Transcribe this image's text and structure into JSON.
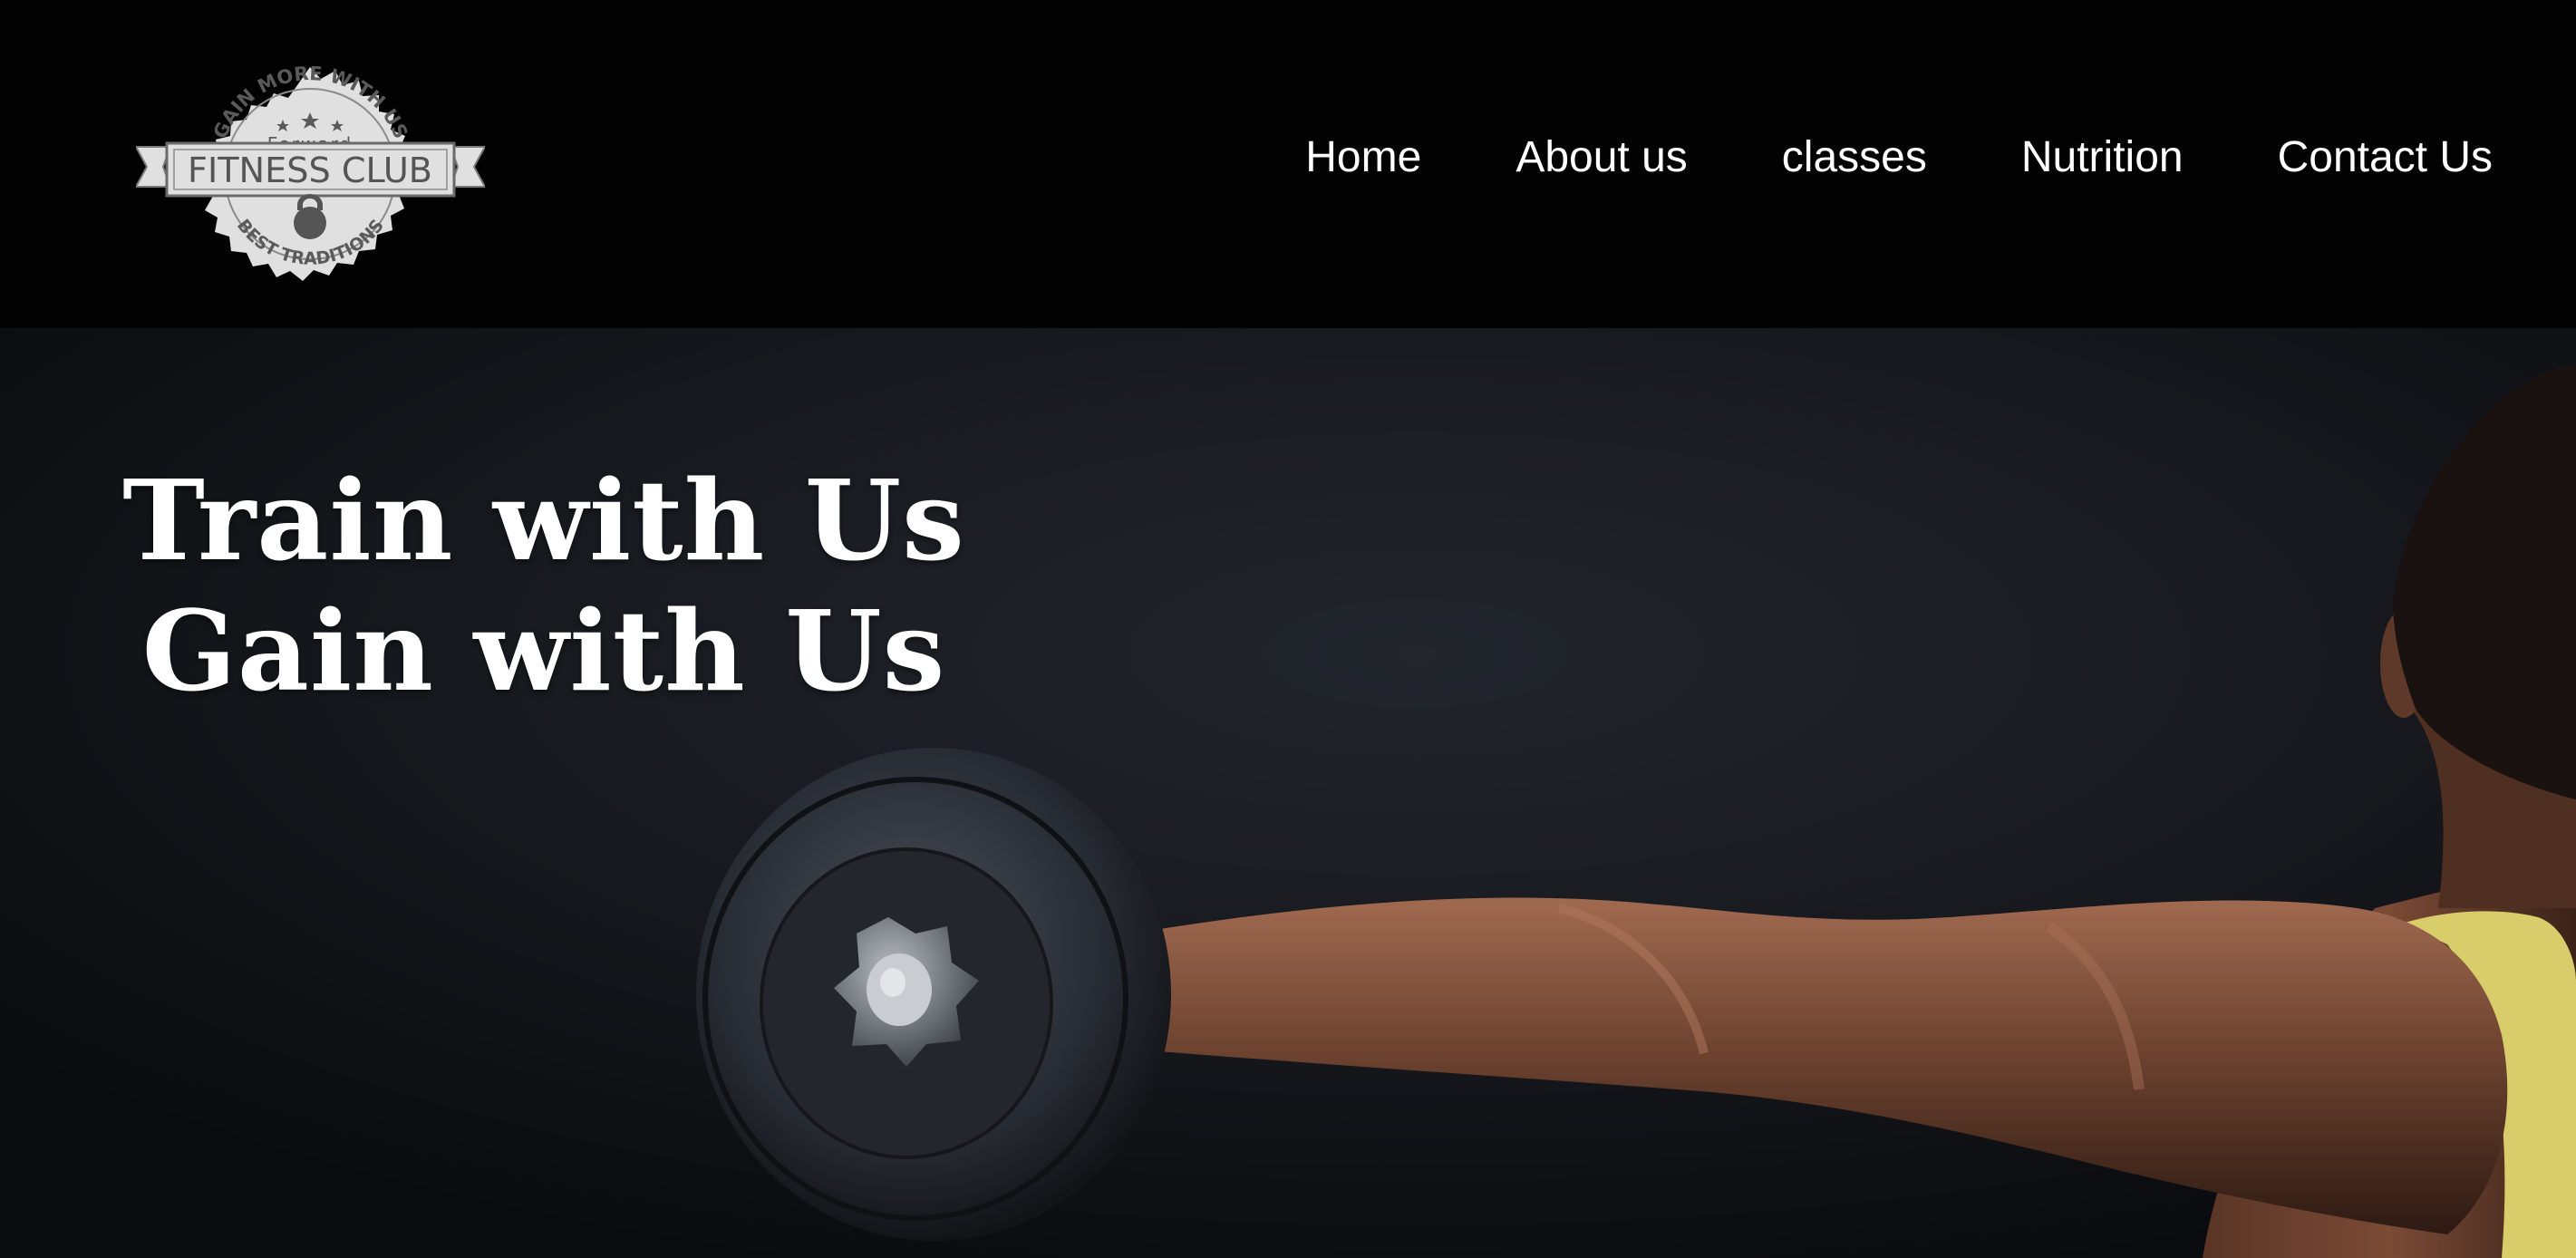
{
  "logo": {
    "arc_top": "GAIN MORE WITH US",
    "subtitle": "Forward",
    "banner": "FITNESS CLUB",
    "arc_bottom": "BEST TRADITIONS"
  },
  "nav": {
    "items": [
      {
        "label": "Home"
      },
      {
        "label": "About us"
      },
      {
        "label": "classes"
      },
      {
        "label": "Nutrition"
      },
      {
        "label": "Contact Us"
      }
    ]
  },
  "hero": {
    "line1": "Train with Us",
    "line2": "Gain with Us"
  },
  "colors": {
    "header_bg": "#020202",
    "hero_bg": "#14161b",
    "text": "#ffffff",
    "logo_fill": "#e0e0e0",
    "logo_ink": "#555555",
    "shirt": "#d9cc6a",
    "skin": "#6e4330"
  }
}
